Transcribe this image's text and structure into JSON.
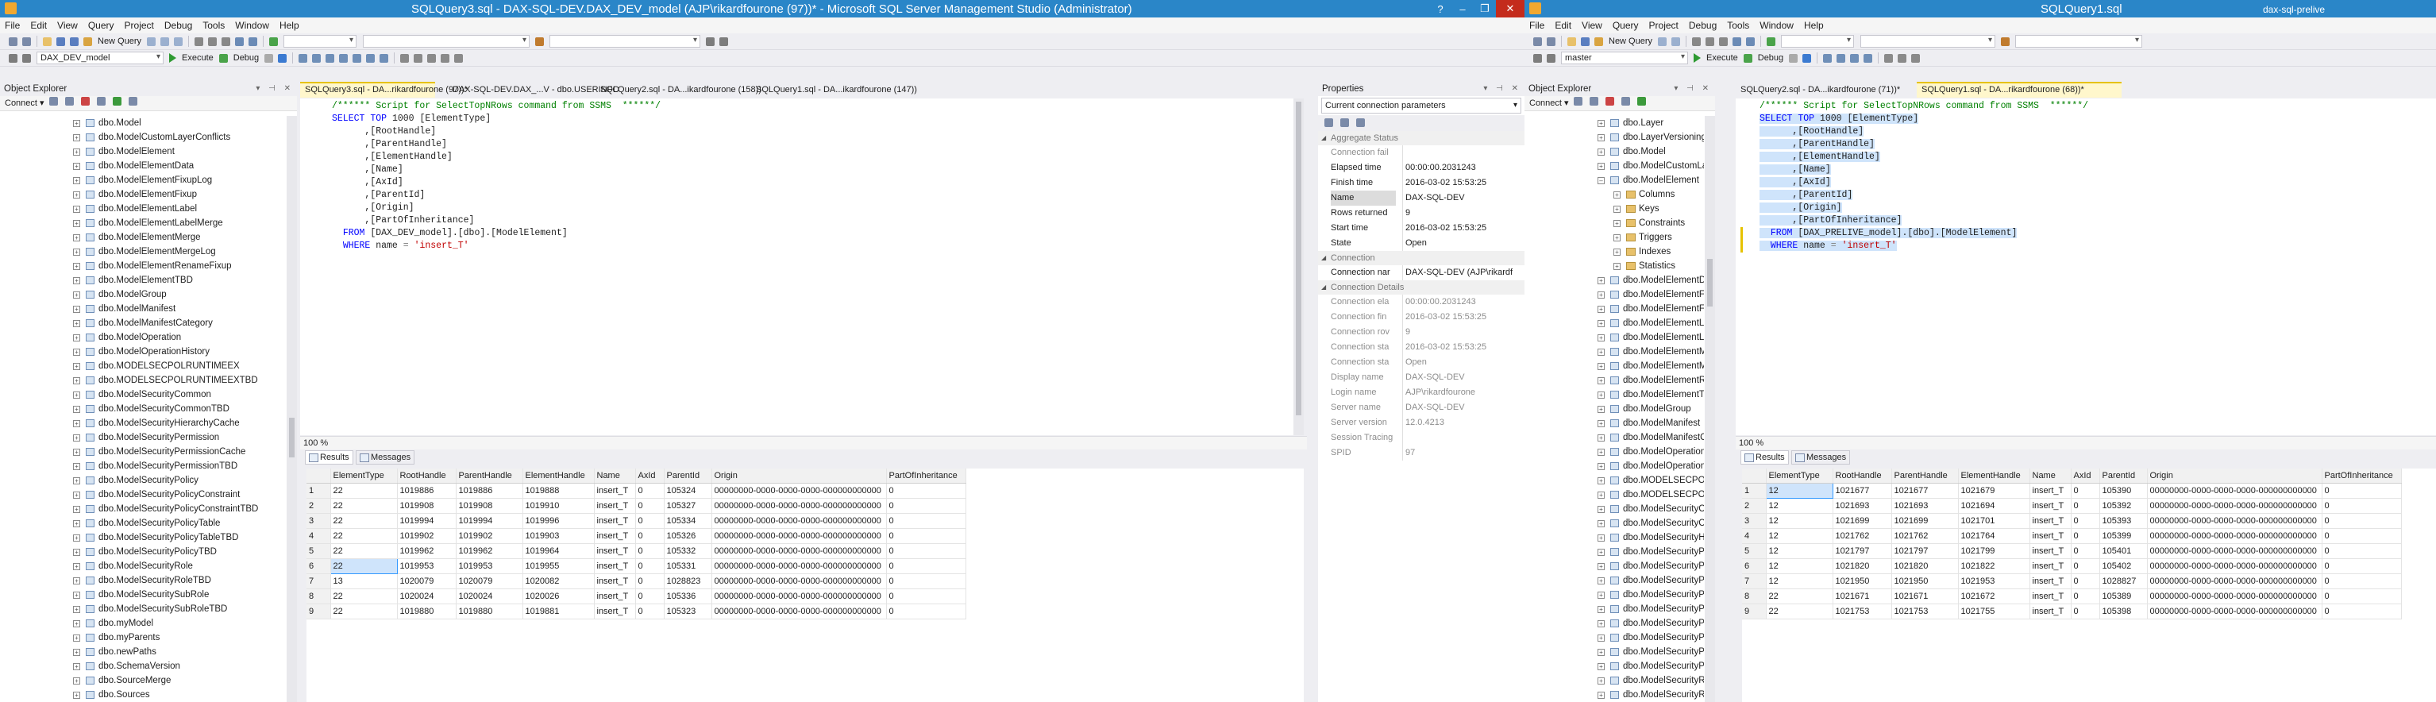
{
  "left": {
    "title": "SQLQuery3.sql - DAX-SQL-DEV.DAX_DEV_model (AJP\\rikardfourone (97))* - Microsoft SQL Server Management Studio (Administrator)",
    "menu": [
      "File",
      "Edit",
      "View",
      "Query",
      "Project",
      "Debug",
      "Tools",
      "Window",
      "Help"
    ],
    "new_query": "New Query",
    "db_combo": "DAX_DEV_model",
    "execute": "Execute",
    "debug": "Debug",
    "object_explorer": {
      "title": "Object Explorer",
      "connect": "Connect ▾",
      "items": [
        "dbo.Model",
        "dbo.ModelCustomLayerConflicts",
        "dbo.ModelElement",
        "dbo.ModelElementData",
        "dbo.ModelElementFixupLog",
        "dbo.ModelElementFixup",
        "dbo.ModelElementLabel",
        "dbo.ModelElementLabelMerge",
        "dbo.ModelElementMerge",
        "dbo.ModelElementMergeLog",
        "dbo.ModelElementRenameFixup",
        "dbo.ModelElementTBD",
        "dbo.ModelGroup",
        "dbo.ModelManifest",
        "dbo.ModelManifestCategory",
        "dbo.ModelOperation",
        "dbo.ModelOperationHistory",
        "dbo.MODELSECPOLRUNTIMEEX",
        "dbo.MODELSECPOLRUNTIMEEXTBD",
        "dbo.ModelSecurityCommon",
        "dbo.ModelSecurityCommonTBD",
        "dbo.ModelSecurityHierarchyCache",
        "dbo.ModelSecurityPermission",
        "dbo.ModelSecurityPermissionCache",
        "dbo.ModelSecurityPermissionTBD",
        "dbo.ModelSecurityPolicy",
        "dbo.ModelSecurityPolicyConstraint",
        "dbo.ModelSecurityPolicyConstraintTBD",
        "dbo.ModelSecurityPolicyTable",
        "dbo.ModelSecurityPolicyTableTBD",
        "dbo.ModelSecurityPolicyTBD",
        "dbo.ModelSecurityRole",
        "dbo.ModelSecurityRoleTBD",
        "dbo.ModelSecuritySubRole",
        "dbo.ModelSecuritySubRoleTBD",
        "dbo.myModel",
        "dbo.myParents",
        "dbo.newPaths",
        "dbo.SchemaVersion",
        "dbo.SourceMerge",
        "dbo.Sources"
      ]
    },
    "tabs": [
      "SQLQuery3.sql - DA...rikardfourone (97))*",
      "DAX-SQL-DEV.DAX_...V - dbo.USERINFO",
      "SQLQuery2.sql - DA...ikardfourone (158))",
      "SQLQuery1.sql - DA...ikardfourone (147))"
    ],
    "code": {
      "l1": "/****** Script for SelectTopNRows command from SSMS  ******/",
      "select": "SELECT",
      "top": "TOP",
      "top_n": " 1000 ",
      "col1": "[ElementType]",
      "cols": [
        "      ,[RootHandle]",
        "      ,[ParentHandle]",
        "      ,[ElementHandle]",
        "      ,[Name]",
        "      ,[AxId]",
        "      ,[ParentId]",
        "      ,[Origin]",
        "      ,[PartOfInheritance]"
      ],
      "from": "FROM",
      "from_obj": " [DAX_DEV_model].[dbo].[ModelElement]",
      "where": "WHERE",
      "where_mid": " name ",
      "eq": "=",
      "where_val": "'insert_T'"
    },
    "zoom": "100 %",
    "results_tab": "Results",
    "messages_tab": "Messages",
    "grid": {
      "headers": [
        "ElementType",
        "RootHandle",
        "ParentHandle",
        "ElementHandle",
        "Name",
        "AxId",
        "ParentId",
        "Origin",
        "PartOfInheritance"
      ],
      "rows": [
        [
          "1",
          "22",
          "1019886",
          "1019886",
          "1019888",
          "insert_T",
          "0",
          "105324",
          "00000000-0000-0000-0000-000000000000",
          "0"
        ],
        [
          "2",
          "22",
          "1019908",
          "1019908",
          "1019910",
          "insert_T",
          "0",
          "105327",
          "00000000-0000-0000-0000-000000000000",
          "0"
        ],
        [
          "3",
          "22",
          "1019994",
          "1019994",
          "1019996",
          "insert_T",
          "0",
          "105334",
          "00000000-0000-0000-0000-000000000000",
          "0"
        ],
        [
          "4",
          "22",
          "1019902",
          "1019902",
          "1019903",
          "insert_T",
          "0",
          "105326",
          "00000000-0000-0000-0000-000000000000",
          "0"
        ],
        [
          "5",
          "22",
          "1019962",
          "1019962",
          "1019964",
          "insert_T",
          "0",
          "105332",
          "00000000-0000-0000-0000-000000000000",
          "0"
        ],
        [
          "6",
          "22",
          "1019953",
          "1019953",
          "1019955",
          "insert_T",
          "0",
          "105331",
          "00000000-0000-0000-0000-000000000000",
          "0"
        ],
        [
          "7",
          "13",
          "1020079",
          "1020079",
          "1020082",
          "insert_T",
          "0",
          "1028823",
          "00000000-0000-0000-0000-000000000000",
          "0"
        ],
        [
          "8",
          "22",
          "1020024",
          "1020024",
          "1020026",
          "insert_T",
          "0",
          "105336",
          "00000000-0000-0000-0000-000000000000",
          "0"
        ],
        [
          "9",
          "22",
          "1019880",
          "1019880",
          "1019881",
          "insert_T",
          "0",
          "105323",
          "00000000-0000-0000-0000-000000000000",
          "0"
        ]
      ]
    },
    "properties": {
      "title": "Properties",
      "combo": "Current connection parameters",
      "cat1": "Aggregate Status",
      "rows1": [
        [
          "Connection fail",
          ""
        ],
        [
          "Elapsed time",
          "00:00:00.2031243"
        ],
        [
          "Finish time",
          "2016-03-02 15:53:25"
        ],
        [
          "Name",
          "DAX-SQL-DEV"
        ],
        [
          "Rows returned",
          "9"
        ],
        [
          "Start time",
          "2016-03-02 15:53:25"
        ],
        [
          "State",
          "Open"
        ]
      ],
      "cat2": "Connection",
      "rows2": [
        [
          "Connection nar",
          "DAX-SQL-DEV (AJP\\rikardf"
        ]
      ],
      "cat3": "Connection Details",
      "rows3": [
        [
          "Connection ela",
          "00:00:00.2031243"
        ],
        [
          "Connection fin",
          "2016-03-02 15:53:25"
        ],
        [
          "Connection rov",
          "9"
        ],
        [
          "Connection sta",
          "2016-03-02 15:53:25"
        ],
        [
          "Connection sta",
          "Open"
        ],
        [
          "Display name",
          "DAX-SQL-DEV"
        ],
        [
          "Login name",
          "AJP\\rikardfourone"
        ],
        [
          "Server name",
          "DAX-SQL-DEV"
        ],
        [
          "Server version",
          "12.0.4213"
        ],
        [
          "Session Tracing",
          ""
        ],
        [
          "SPID",
          "97"
        ]
      ]
    }
  },
  "right": {
    "title": "SQLQuery1.sql",
    "title2": "dax-sql-prelive",
    "menu": [
      "File",
      "Edit",
      "View",
      "Query",
      "Project",
      "Debug",
      "Tools",
      "Window",
      "Help"
    ],
    "new_query": "New Query",
    "db_combo": "master",
    "execute": "Execute",
    "debug": "Debug",
    "object_explorer": {
      "title": "Object Explorer",
      "connect": "Connect ▾",
      "items": [
        {
          "label": "dbo.Layer",
          "indent": 0,
          "icon": "table"
        },
        {
          "label": "dbo.LayerVersioning",
          "indent": 0,
          "icon": "table"
        },
        {
          "label": "dbo.Model",
          "indent": 0,
          "icon": "table"
        },
        {
          "label": "dbo.ModelCustomLa",
          "indent": 0,
          "icon": "table"
        },
        {
          "label": "dbo.ModelElement",
          "indent": 0,
          "icon": "table",
          "expanded": true
        },
        {
          "label": "Columns",
          "indent": 1,
          "icon": "folder"
        },
        {
          "label": "Keys",
          "indent": 1,
          "icon": "folder"
        },
        {
          "label": "Constraints",
          "indent": 1,
          "icon": "folder"
        },
        {
          "label": "Triggers",
          "indent": 1,
          "icon": "folder"
        },
        {
          "label": "Indexes",
          "indent": 1,
          "icon": "folder"
        },
        {
          "label": "Statistics",
          "indent": 1,
          "icon": "folder"
        },
        {
          "label": "dbo.ModelElementDa",
          "indent": 0,
          "icon": "table"
        },
        {
          "label": "dbo.ModelElementFi",
          "indent": 0,
          "icon": "table"
        },
        {
          "label": "dbo.ModelElementFi",
          "indent": 0,
          "icon": "table"
        },
        {
          "label": "dbo.ModelElementLa",
          "indent": 0,
          "icon": "table"
        },
        {
          "label": "dbo.ModelElementLa",
          "indent": 0,
          "icon": "table"
        },
        {
          "label": "dbo.ModelElementM",
          "indent": 0,
          "icon": "table"
        },
        {
          "label": "dbo.ModelElementM",
          "indent": 0,
          "icon": "table"
        },
        {
          "label": "dbo.ModelElementRe",
          "indent": 0,
          "icon": "table"
        },
        {
          "label": "dbo.ModelElementTE",
          "indent": 0,
          "icon": "table"
        },
        {
          "label": "dbo.ModelGroup",
          "indent": 0,
          "icon": "table"
        },
        {
          "label": "dbo.ModelManifest",
          "indent": 0,
          "icon": "table"
        },
        {
          "label": "dbo.ModelManifestC",
          "indent": 0,
          "icon": "table"
        },
        {
          "label": "dbo.ModelOperation",
          "indent": 0,
          "icon": "table"
        },
        {
          "label": "dbo.ModelOperationl",
          "indent": 0,
          "icon": "table"
        },
        {
          "label": "dbo.MODELSECPOLR",
          "indent": 0,
          "icon": "table"
        },
        {
          "label": "dbo.MODELSECPOLR",
          "indent": 0,
          "icon": "table"
        },
        {
          "label": "dbo.ModelSecurityCo",
          "indent": 0,
          "icon": "table"
        },
        {
          "label": "dbo.ModelSecurityCo",
          "indent": 0,
          "icon": "table"
        },
        {
          "label": "dbo.ModelSecurityHi",
          "indent": 0,
          "icon": "table"
        },
        {
          "label": "dbo.ModelSecurityPe",
          "indent": 0,
          "icon": "table"
        },
        {
          "label": "dbo.ModelSecurityPe",
          "indent": 0,
          "icon": "table"
        },
        {
          "label": "dbo.ModelSecurityPe",
          "indent": 0,
          "icon": "table"
        },
        {
          "label": "dbo.ModelSecurityPo",
          "indent": 0,
          "icon": "table"
        },
        {
          "label": "dbo.ModelSecurityPo",
          "indent": 0,
          "icon": "table"
        },
        {
          "label": "dbo.ModelSecurityPo",
          "indent": 0,
          "icon": "table"
        },
        {
          "label": "dbo.ModelSecurityPo",
          "indent": 0,
          "icon": "table"
        },
        {
          "label": "dbo.ModelSecurityPo",
          "indent": 0,
          "icon": "table"
        },
        {
          "label": "dbo.ModelSecurityPo",
          "indent": 0,
          "icon": "table"
        },
        {
          "label": "dbo.ModelSecurityRo",
          "indent": 0,
          "icon": "table"
        },
        {
          "label": "dbo.ModelSecurityRo",
          "indent": 0,
          "icon": "table"
        }
      ]
    },
    "tabs": [
      "SQLQuery2.sql - DA...ikardfourone (71))*",
      "SQLQuery1.sql - DA...rikardfourone (68))*"
    ],
    "code": {
      "l1": "/****** Script for SelectTopNRows command from SSMS  ******/",
      "select": "SELECT",
      "top": "TOP",
      "top_n": " 1000 ",
      "col1": "[ElementType]",
      "cols": [
        "      ,[RootHandle]",
        "      ,[ParentHandle]",
        "      ,[ElementHandle]",
        "      ,[Name]",
        "      ,[AxId]",
        "      ,[ParentId]",
        "      ,[Origin]",
        "      ,[PartOfInheritance]"
      ],
      "from": "FROM",
      "from_obj": " [DAX_PRELIVE_model].[dbo].[ModelElement]",
      "where": "WHERE",
      "where_mid": " name ",
      "eq": "=",
      "where_val": "'insert_T'"
    },
    "zoom": "100 %",
    "results_tab": "Results",
    "messages_tab": "Messages",
    "grid": {
      "headers": [
        "ElementType",
        "RootHandle",
        "ParentHandle",
        "ElementHandle",
        "Name",
        "AxId",
        "ParentId",
        "Origin",
        "PartOfInheritance"
      ],
      "rows": [
        [
          "1",
          "12",
          "1021677",
          "1021677",
          "1021679",
          "insert_T",
          "0",
          "105390",
          "00000000-0000-0000-0000-000000000000",
          "0"
        ],
        [
          "2",
          "12",
          "1021693",
          "1021693",
          "1021694",
          "insert_T",
          "0",
          "105392",
          "00000000-0000-0000-0000-000000000000",
          "0"
        ],
        [
          "3",
          "12",
          "1021699",
          "1021699",
          "1021701",
          "insert_T",
          "0",
          "105393",
          "00000000-0000-0000-0000-000000000000",
          "0"
        ],
        [
          "4",
          "12",
          "1021762",
          "1021762",
          "1021764",
          "insert_T",
          "0",
          "105399",
          "00000000-0000-0000-0000-000000000000",
          "0"
        ],
        [
          "5",
          "12",
          "1021797",
          "1021797",
          "1021799",
          "insert_T",
          "0",
          "105401",
          "00000000-0000-0000-0000-000000000000",
          "0"
        ],
        [
          "6",
          "12",
          "1021820",
          "1021820",
          "1021822",
          "insert_T",
          "0",
          "105402",
          "00000000-0000-0000-0000-000000000000",
          "0"
        ],
        [
          "7",
          "12",
          "1021950",
          "1021950",
          "1021953",
          "insert_T",
          "0",
          "1028827",
          "00000000-0000-0000-0000-000000000000",
          "0"
        ],
        [
          "8",
          "22",
          "1021671",
          "1021671",
          "1021672",
          "insert_T",
          "0",
          "105389",
          "00000000-0000-0000-0000-000000000000",
          "0"
        ],
        [
          "9",
          "22",
          "1021753",
          "1021753",
          "1021755",
          "insert_T",
          "0",
          "105398",
          "00000000-0000-0000-0000-000000000000",
          "0"
        ]
      ]
    }
  }
}
